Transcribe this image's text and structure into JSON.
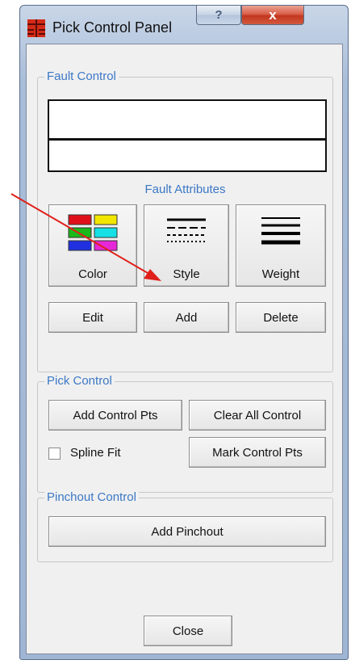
{
  "window": {
    "title": "Pick Control Panel",
    "help_label": "?",
    "close_label": "x"
  },
  "fault_control": {
    "legend": "Fault Control",
    "attributes_label": "Fault Attributes",
    "color_label": "Color",
    "style_label": "Style",
    "weight_label": "Weight",
    "edit_label": "Edit",
    "add_label": "Add",
    "delete_label": "Delete"
  },
  "pick_control": {
    "legend": "Pick Control",
    "add_control_pts_label": "Add Control Pts",
    "clear_all_control_label": "Clear All Control",
    "spline_fit_label": "Spline Fit",
    "spline_fit_checked": false,
    "mark_control_pts_label": "Mark Control Pts"
  },
  "pinchout_control": {
    "legend": "Pinchout Control",
    "add_pinchout_label": "Add Pinchout"
  },
  "footer": {
    "close_label": "Close"
  },
  "colors": {
    "accent_text": "#3c78c6",
    "annotation_arrow": "#e0201b",
    "color_swatches": [
      "#e0101a",
      "#f2e600",
      "#1ab81a",
      "#14e0e6",
      "#2030e0",
      "#e628d8"
    ]
  }
}
